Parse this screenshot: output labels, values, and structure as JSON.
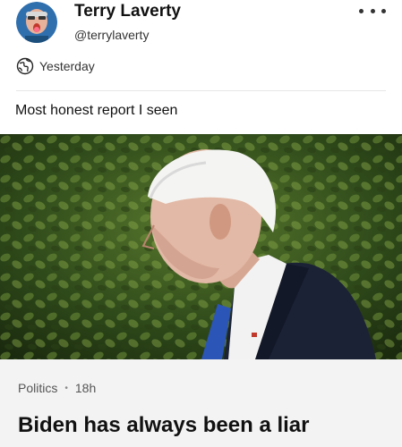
{
  "post": {
    "author_name": "Terry Laverty",
    "author_handle": "@terrylaverty",
    "timestamp": "Yesterday",
    "visibility_icon": "globe-icon",
    "body_text": "Most honest report I seen",
    "more_icon": "more-options-icon"
  },
  "article": {
    "category": "Politics",
    "age": "18h",
    "separator": "•",
    "title": "Biden has always been a liar"
  },
  "colors": {
    "background": "#ffffff",
    "card_background": "#f3f3f3",
    "text_primary": "#111111",
    "text_secondary": "#555555",
    "divider": "#e6e6e6"
  }
}
